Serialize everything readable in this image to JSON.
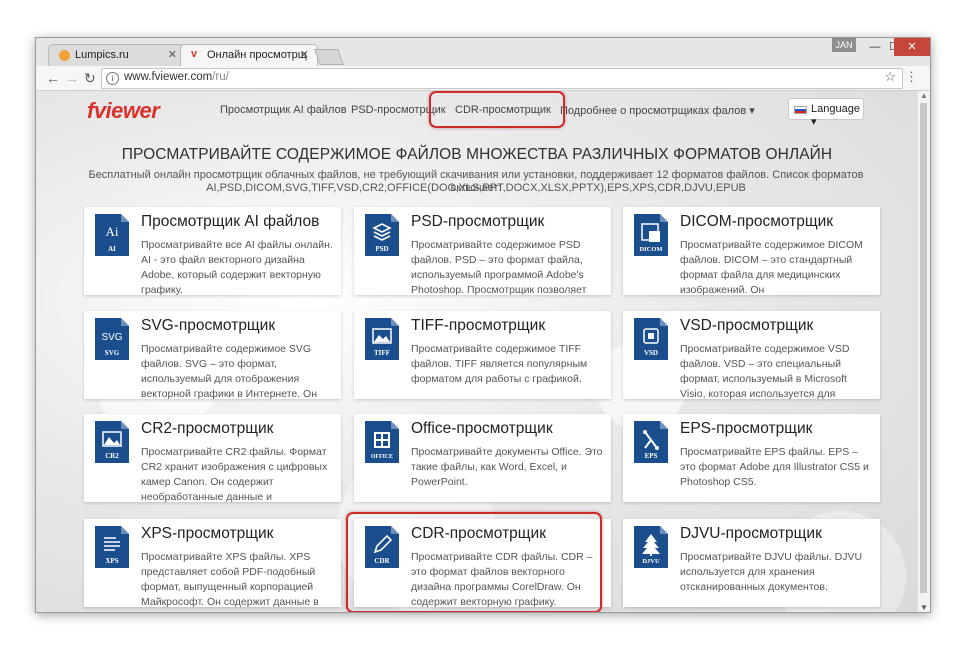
{
  "browser": {
    "tabs": [
      {
        "title": "Lumpics.ru",
        "favicon": "lumpics-favicon",
        "active": false
      },
      {
        "title": "Онлайн просмотрщик ф",
        "favicon": "fviewer-favicon",
        "active": true
      }
    ],
    "user_badge": "JAN",
    "window_buttons": [
      "—",
      "☐",
      "✕"
    ],
    "url_host": "www.fviewer.com",
    "url_path": "/ru/"
  },
  "site": {
    "logo": "fviewer",
    "nav": [
      {
        "label": "Просмотрщик AI файлов"
      },
      {
        "label": "PSD-просмотрщик"
      },
      {
        "label": "CDR-просмотрщик"
      },
      {
        "label": "Подробнее о просмотрщиках фалов ▾"
      }
    ],
    "language_button": "Language ▾",
    "headline": "ПРОСМАТРИВАЙТЕ СОДЕРЖИМОЕ ФАЙЛОВ МНОЖЕСТВА РАЗЛИЧНЫХ ФОРМАТОВ ОНЛАЙН",
    "subtext_line1": "Бесплатный онлайн просмотрщик облачных файлов, не требующий скачивания или установки, поддерживает 12 форматов файлов. Список форматов включает:",
    "subtext_line2": "AI,PSD,DICOM,SVG,TIFF,VSD,CR2,OFFICE(DOC,XLS,PPT,DOCX,XLSX,PPTX),EPS,XPS,CDR,DJVU,EPUB"
  },
  "cards": [
    {
      "icon_label": "AI",
      "big_label": "Ai",
      "title": "Просмотрщик AI файлов",
      "desc": "Просматривайте все AI файлы онлайн. AI - это файл векторного дизайна Adobe, который содержит векторную графику."
    },
    {
      "icon_label": "PSD",
      "title": "PSD-просмотрщик",
      "desc": "Просматривайте содержимое PSD файлов. PSD – это формат файла, используемый программой Adobe's Photoshop. Просмотрщик позволяет"
    },
    {
      "icon_label": "DICOM",
      "title": "DICOM-просмотрщик",
      "desc": "Просматривайте содержимое DICOM файлов. DICOM – это стандартный формат файла для медицинских изображений. Он"
    },
    {
      "icon_label": "SVG",
      "big_label": "SVG",
      "title": "SVG-просмотрщик",
      "desc": "Просматривайте содержимое SVG файлов. SVG – это формат, используемый для отображения векторной графики в Интернете. Он"
    },
    {
      "icon_label": "TIFF",
      "title": "TIFF-просмотрщик",
      "desc": "Просматривайте содержимое TIFF файлов. TIFF является популярным форматом для работы с графикой."
    },
    {
      "icon_label": "VSD",
      "title": "VSD-просмотрщик",
      "desc": "Просматривайте содержимое VSD файлов. VSD – это специальный формат, используемый в Microsoft Visio, которая используется для"
    },
    {
      "icon_label": "CR2",
      "title": "CR2-просмотрщик",
      "desc": "Просматривайте CR2 файлы. Формат CR2 хранит изображения с цифровых камер Canon. Он содержит необработанные данные и"
    },
    {
      "icon_label": "OFFICE",
      "title": "Office-просмотрщик",
      "desc": "Просматривайте документы Office. Это такие файлы, как Word, Excel, и PowerPoint."
    },
    {
      "icon_label": "EPS",
      "title": "EPS-просмотрщик",
      "desc": "Просматривайте EPS файлы. EPS – это формат Adobe для Illustrator CS5 и Photoshop CS5."
    },
    {
      "icon_label": "XPS",
      "title": "XPS-просмотрщик",
      "desc": "Просматривайте XPS файлы. XPS представляет собой PDF-подобный формат, выпущенный корпорацией Майкрософт. Он содержит данные в"
    },
    {
      "icon_label": "CDR",
      "title": "CDR-просмотрщик",
      "desc": "Просматривайте CDR файлы. CDR – это формат файлов векторного дизайна программы CorelDraw. Он содержит векторную графику."
    },
    {
      "icon_label": "DJVU",
      "title": "DJVU-просмотрщик",
      "desc": "Просматривайте DJVU файлы. DJVU используется для хранения отсканированных документов."
    }
  ],
  "colors": {
    "accent": "#d8322b",
    "icon_blue": "#1a4e8c",
    "highlight": "#cf2a2a"
  }
}
